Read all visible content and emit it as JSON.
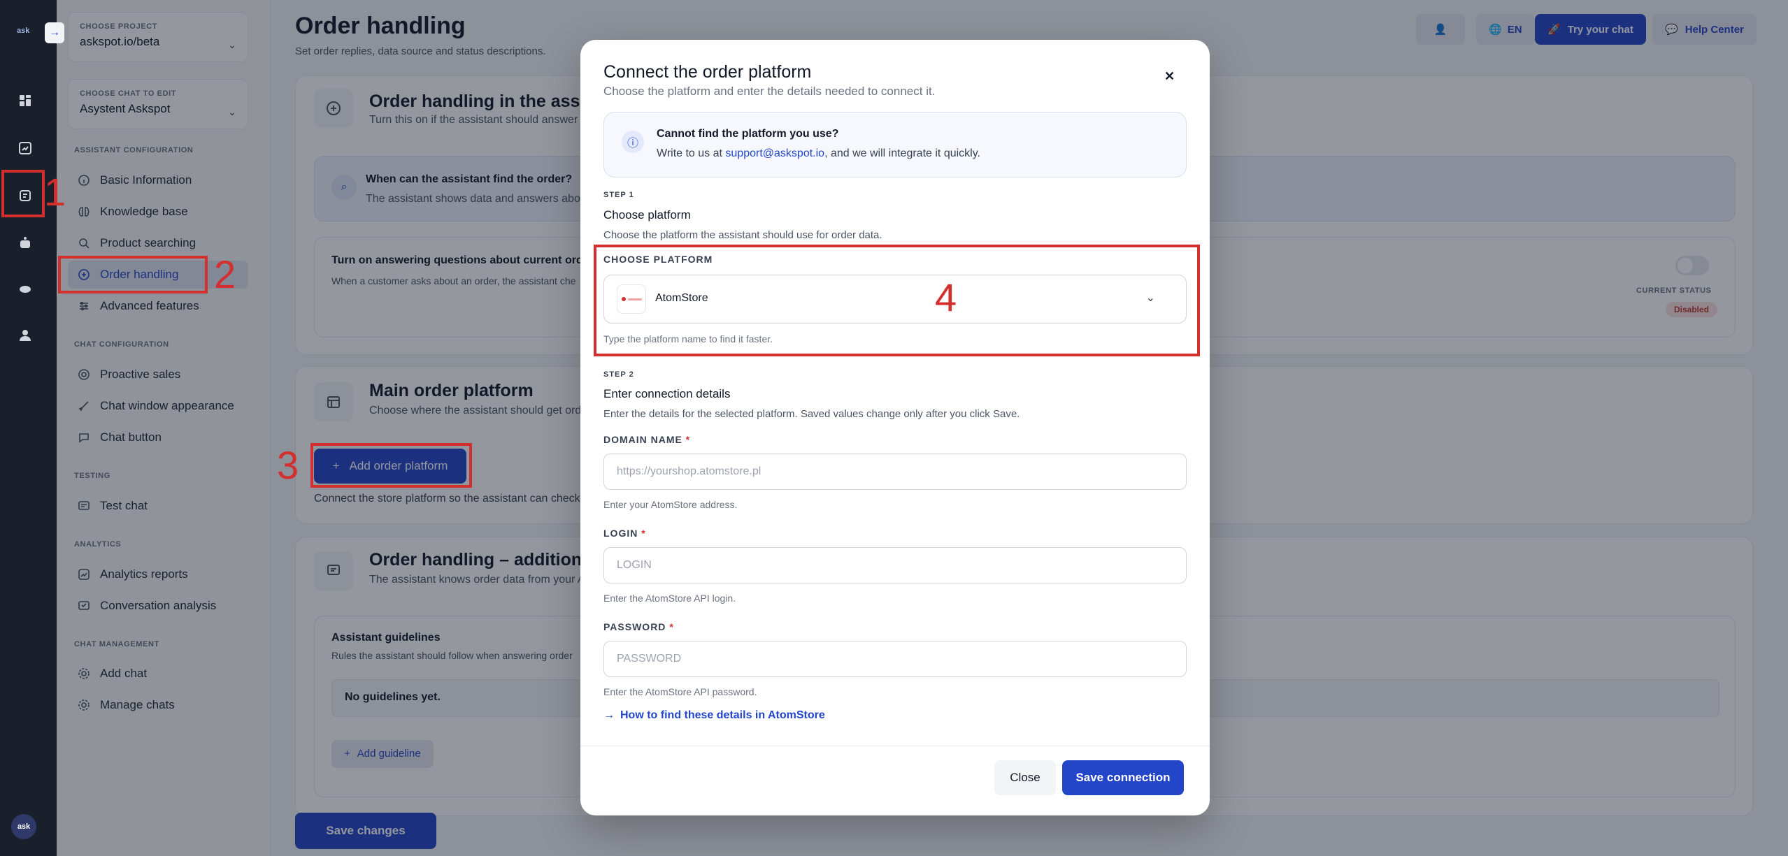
{
  "rail": {
    "logo_text": "ask",
    "avatar_text": "ask"
  },
  "sidebar": {
    "project_label": "CHOOSE PROJECT",
    "project_value": "askspot.io/beta",
    "chat_label": "CHOOSE CHAT TO EDIT",
    "chat_value": "Asystent Askspot",
    "sections": {
      "assistant": "ASSISTANT CONFIGURATION",
      "chat": "CHAT CONFIGURATION",
      "testing": "TESTING",
      "analytics": "ANALYTICS",
      "management": "CHAT MANAGEMENT"
    },
    "items": {
      "basic": "Basic Information",
      "knowledge": "Knowledge base",
      "product": "Product searching",
      "order": "Order handling",
      "advanced": "Advanced features",
      "proactive": "Proactive sales",
      "appearance": "Chat window appearance",
      "button": "Chat button",
      "test": "Test chat",
      "reports": "Analytics reports",
      "conversation": "Conversation analysis",
      "add_chat": "Add chat",
      "manage_chats": "Manage chats"
    }
  },
  "header": {
    "title": "Order handling",
    "subtitle": "Set order replies, data source and status descriptions.",
    "lang": "EN",
    "try_chat": "Try your chat",
    "help": "Help Center"
  },
  "main": {
    "card1_title": "Order handling in the assistant",
    "card1_sub": "Turn this on if the assistant should answer q",
    "find_title": "When can the assistant find the order?",
    "find_sub": "The assistant shows data and answers abou",
    "toggle_title": "Turn on answering questions about current orders",
    "toggle_sub": "When a customer asks about an order, the assistant che",
    "status_label": "CURRENT STATUS",
    "status_value": "Disabled",
    "card2_title": "Main order platform",
    "card2_sub": "Choose where the assistant should get orde",
    "add_platform": "Add order platform",
    "connect_text": "Connect the store platform so the assistant can check o",
    "card3_title": "Order handling – additional in",
    "card3_sub": "The assistant knows order data from your A",
    "guidelines_title": "Assistant guidelines",
    "guidelines_sub": "Rules the assistant should follow when answering order",
    "no_guidelines": "No guidelines yet.",
    "add_guideline": "Add guideline",
    "save_changes": "Save changes"
  },
  "annotations": {
    "n1": "1",
    "n2": "2",
    "n3": "3",
    "n4": "4"
  },
  "modal": {
    "title": "Connect the order platform",
    "subtitle": "Choose the platform and enter the details needed to connect it.",
    "info_title": "Cannot find the platform you use?",
    "info_pre": "Write to us at ",
    "info_link": "support@askspot.io",
    "info_post": ", and we will integrate it quickly.",
    "step1": "STEP 1",
    "step1_title": "Choose platform",
    "step1_desc": "Choose the platform the assistant should use for order data.",
    "platform_label": "CHOOSE PLATFORM",
    "platform_value": "AtomStore",
    "platform_hint": "Type the platform name to find it faster.",
    "step2": "STEP 2",
    "step2_title": "Enter connection details",
    "step2_desc": "Enter the details for the selected platform. Saved values change only after you click Save.",
    "domain_label": "DOMAIN NAME",
    "domain_placeholder": "https://yourshop.atomstore.pl",
    "domain_hint": "Enter your AtomStore address.",
    "login_label": "LOGIN",
    "login_placeholder": "LOGIN",
    "login_hint": "Enter the AtomStore API login.",
    "password_label": "PASSWORD",
    "password_placeholder": "PASSWORD",
    "password_hint": "Enter the AtomStore API password.",
    "howto": "How to find these details in AtomStore",
    "close": "Close",
    "save": "Save connection"
  }
}
